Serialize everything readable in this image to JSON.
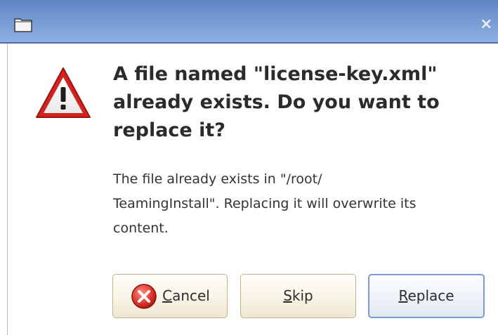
{
  "dialog": {
    "heading": "A file named \"license-key.xml\"\nalready exists.  Do you want to\nreplace it?",
    "message": "The file already exists in \"/root/\nTeamingInstall\".  Replacing it will overwrite its\ncontent.",
    "icons": {
      "title_icon": "folder-icon",
      "close": "close-icon",
      "warning": "warning-icon",
      "cancel": "cancel-icon"
    },
    "close_glyph": "×"
  },
  "buttons": {
    "cancel": {
      "mnemonic": "C",
      "rest": "ancel"
    },
    "skip": {
      "mnemonic": "S",
      "rest": "kip"
    },
    "replace": {
      "mnemonic": "R",
      "rest": "eplace"
    }
  },
  "colors": {
    "titlebar": "#6e93cf",
    "warning_red": "#c8201c",
    "replace_border": "#7b9bcf",
    "button_border": "#c2b48a"
  }
}
